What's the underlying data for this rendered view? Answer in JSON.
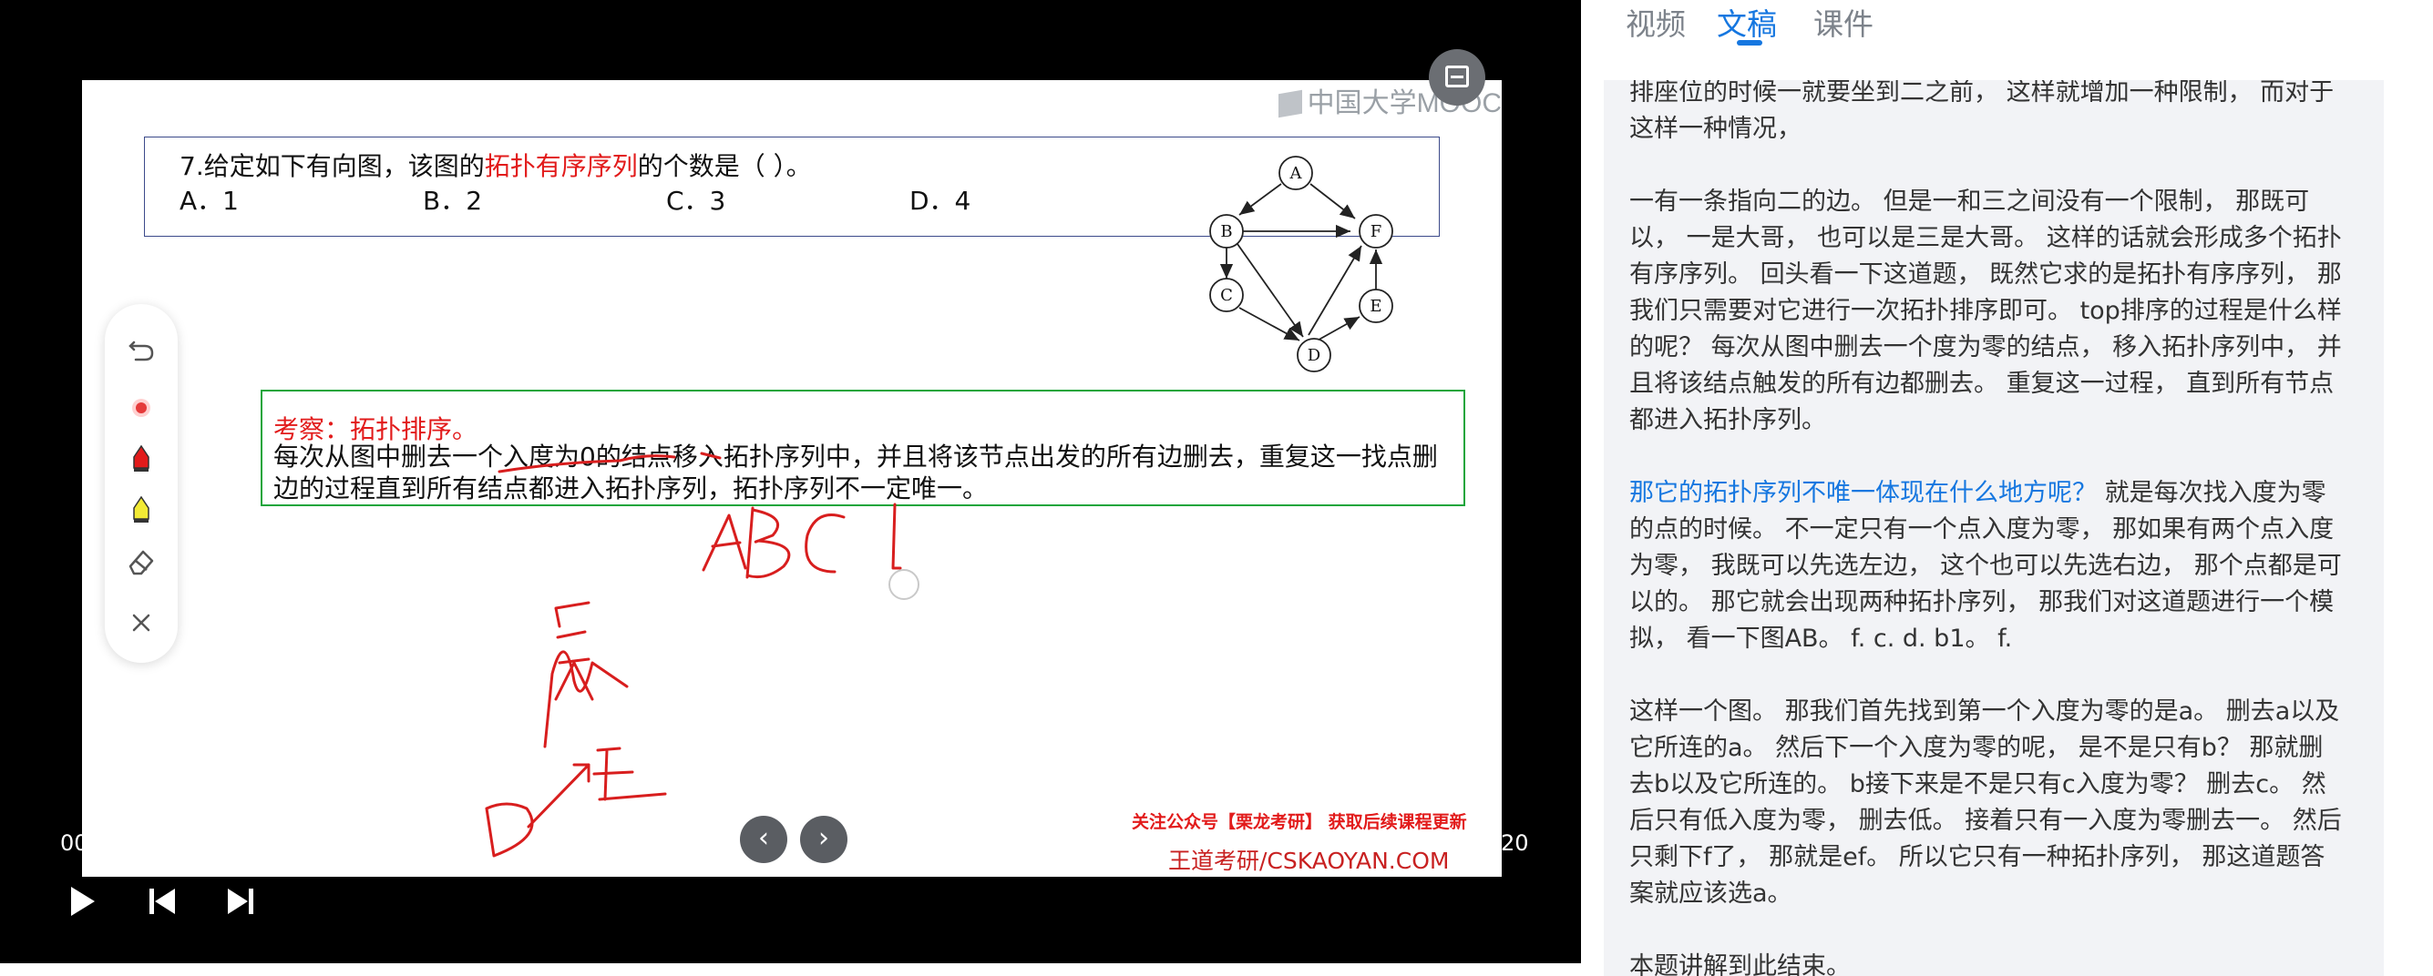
{
  "player": {
    "watermark": "中国大学MOOC",
    "time_current": "00",
    "time_total": "20"
  },
  "slide": {
    "question": {
      "prefix": "7.给定如下有向图，该图的",
      "highlight": "拓扑有序序列",
      "suffix": "的个数是（  ）。",
      "options": [
        "A．1",
        "B．2",
        "C．3",
        "D．4"
      ]
    },
    "graph": {
      "nodes": [
        "A",
        "B",
        "C",
        "D",
        "E",
        "F"
      ]
    },
    "analysis": {
      "title": "考察：拓扑排序。",
      "body": "每次从图中删去一个入度为0的结点移入拓扑序列中，并且将该节点出发的所有边删去，重复这一找点删边的过程直到所有结点都进入拓扑序列，拓扑序列不一定唯一。"
    },
    "footer_note": "关注公众号【栗龙考研】 获取后续课程更新",
    "footer_brand": "王道考研/CSKAOYAN.COM"
  },
  "tabs": [
    {
      "label": "视频",
      "active": false
    },
    {
      "label": "文稿",
      "active": true
    },
    {
      "label": "课件",
      "active": false
    }
  ],
  "transcript": {
    "p1": "一要坐下 一张是就请,  一是三的大哥,  一是三的弟弟。 那现在时候排座位的时候一就要坐到二之前， 这样就增加一种限制， 而对于这样一种情况，",
    "p2": "一有一条指向二的边。 但是一和三之间没有一个限制， 那既可以， 一是大哥， 也可以是三是大哥。 这样的话就会形成多个拓扑有序序列。 回头看一下这道题， 既然它求的是拓扑有序序列， 那我们只需要对它进行一次拓扑排序即可。 top排序的过程是什么样的呢？ 每次从图中删去一个度为零的结点， 移入拓扑序列中， 并且将该结点触发的所有边都删去。 重复这一过程，  直到所有节点都进入拓扑序列。",
    "p3_highlight": "那它的拓扑序列不唯一体现在什么地方呢？",
    "p3_rest": " 就是每次找入度为零的点的时候。 不一定只有一个点入度为零， 那如果有两个点入度为零， 我既可以先选左边， 这个也可以先选右边， 那个点都是可以的。 那它就会出现两种拓扑序列， 那我们对这道题进行一个模拟， 看一下图AB。 f. c. d. b1。 f.",
    "p4": "这样一个图。 那我们首先找到第一个入度为零的是a。 删去a以及它所连的a。 然后下一个入度为零的呢， 是不是只有b？ 那就删去b以及它所连的。 b接下来是不是只有c入度为零？ 删去c。  然后只有低入度为零， 删去低。 接着只有一入度为零删去一。  然后只剩下f了， 那就是ef。 所以它只有一种拓扑序列， 那这道题答案就应该选a。",
    "p5": "本题讲解到此结束。"
  },
  "colors": {
    "accent": "#1677e0",
    "red": "#e21b1b",
    "green_box": "#19a53b"
  }
}
